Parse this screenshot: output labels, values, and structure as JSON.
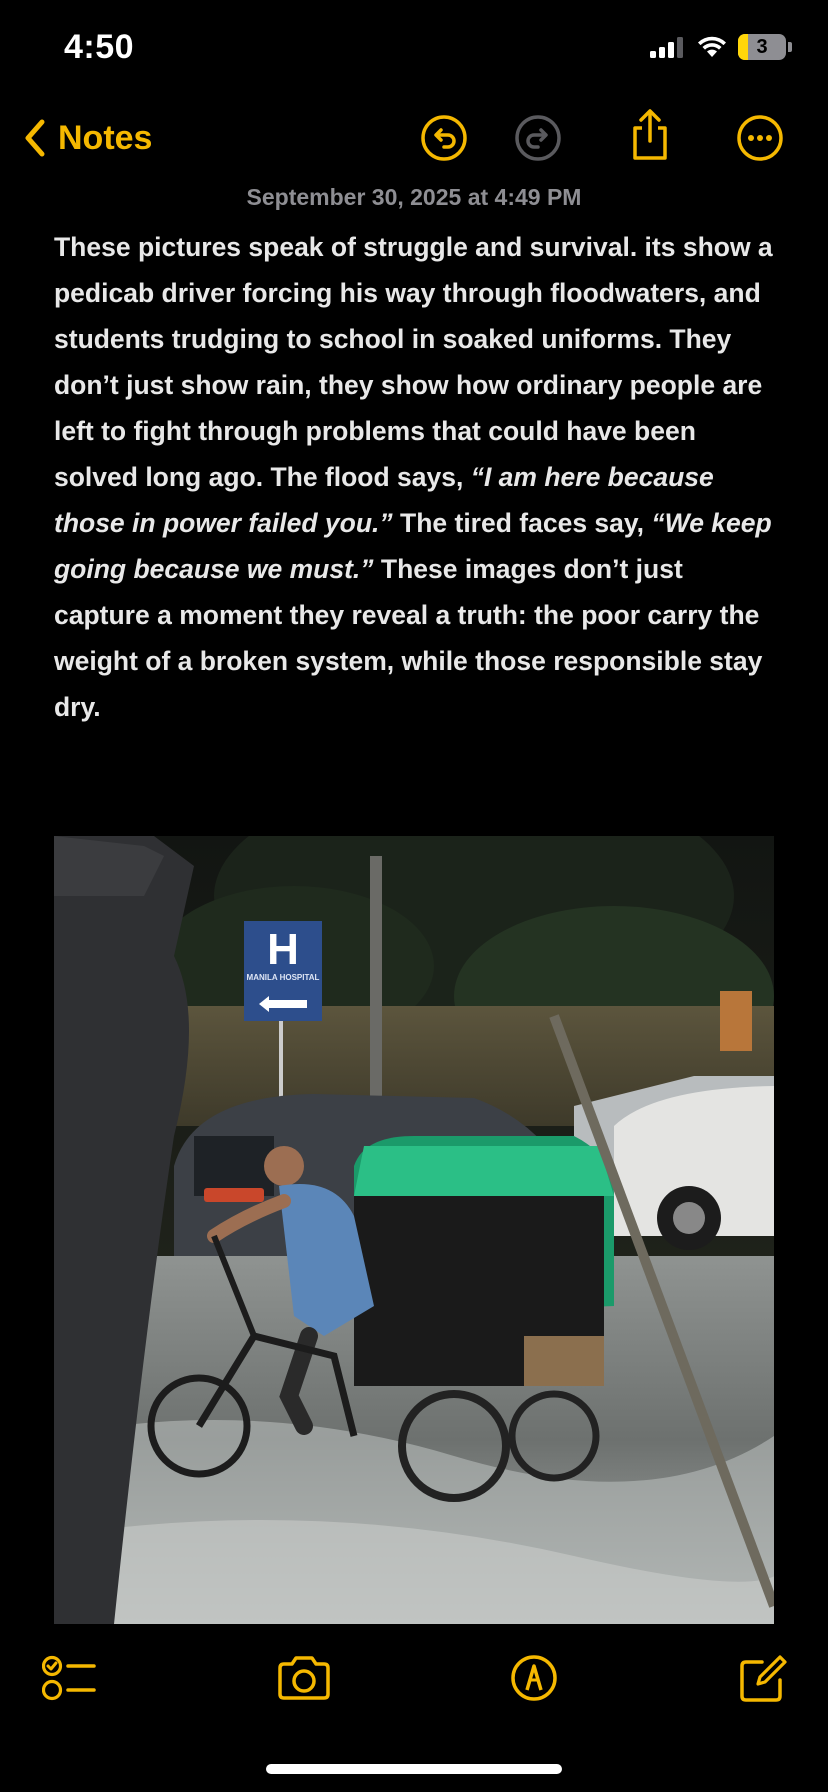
{
  "status_bar": {
    "time": "4:50",
    "battery_level": "3",
    "battery_fraction": 0.03
  },
  "nav": {
    "back_label": "Notes"
  },
  "note": {
    "date": "September 30, 2025 at 4:49 PM",
    "body": {
      "p1": "These pictures speak of struggle and survival. its show a pedicab driver forcing his way through floodwaters, and students trudging to school in soaked uniforms. They don’t just show rain, they show how ordinary people are left to fight through problems that could have been solved long ago. The flood says, ",
      "q1": "“I am here because those in power failed you.”",
      "p2": " The tired faces say, ",
      "q2": "“We keep going because we must.”",
      "p3": " These images don’t just capture a moment they reveal a truth: the poor carry the weight of a broken system, while those responsible stay dry."
    },
    "image": {
      "sign_letter": "H",
      "sign_text": "MANILA HOSPITAL"
    }
  },
  "colors": {
    "accent": "#f5b800",
    "background": "#000000",
    "text": "#e8e8e8",
    "secondary_text": "#8e8e93"
  },
  "icons": {
    "back": "chevron-left-icon",
    "undo": "undo-icon",
    "redo": "redo-icon",
    "share": "share-icon",
    "more": "more-icon",
    "checklist": "checklist-icon",
    "camera": "camera-icon",
    "markup": "markup-icon",
    "compose": "compose-icon"
  }
}
